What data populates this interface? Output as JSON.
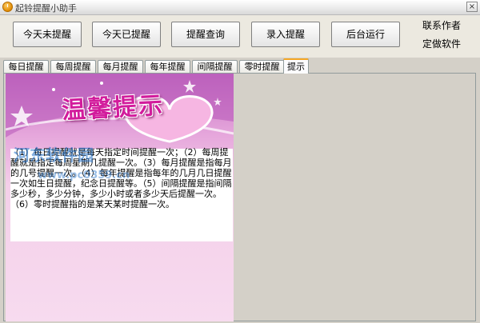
{
  "window": {
    "title": "起铃提醒小助手",
    "close_symbol": "×"
  },
  "toolbar": {
    "buttons": [
      {
        "label": "今天未提醒"
      },
      {
        "label": "今天已提醒"
      },
      {
        "label": "提醒查询"
      },
      {
        "label": "录入提醒"
      },
      {
        "label": "后台运行"
      }
    ],
    "contact_author": "联系作者",
    "custom_software": "定做软件"
  },
  "tabs": [
    {
      "label": "每日提醒"
    },
    {
      "label": "每周提醒"
    },
    {
      "label": "每月提醒"
    },
    {
      "label": "每年提醒"
    },
    {
      "label": "间隔提醒"
    },
    {
      "label": "零时提醒"
    },
    {
      "label": "提示"
    }
  ],
  "active_tab": "提示",
  "content": {
    "banner_title": "温馨提示",
    "intro_text": "（1）每日提醒就是每天指定时间提醒一次；（2）每周提醒就是指定每周星期几提醒一次。（3）每月提醒是指每月的几号提醒一次。（4）每年提醒是指每年的几月几日提醒一次如生日提醒，纪念日提醒等。（5）间隔提醒是指间隔多少秒，多少分钟，多少小时或者多少天后提醒一次。（6）零时提醒指的是某天某时提醒一次。",
    "watermark": "河东软件园",
    "watermark_sub": "www.pc0359.cn"
  },
  "colors": {
    "accent_tab": "#f5a623",
    "banner_pink": "#d21c9c"
  }
}
